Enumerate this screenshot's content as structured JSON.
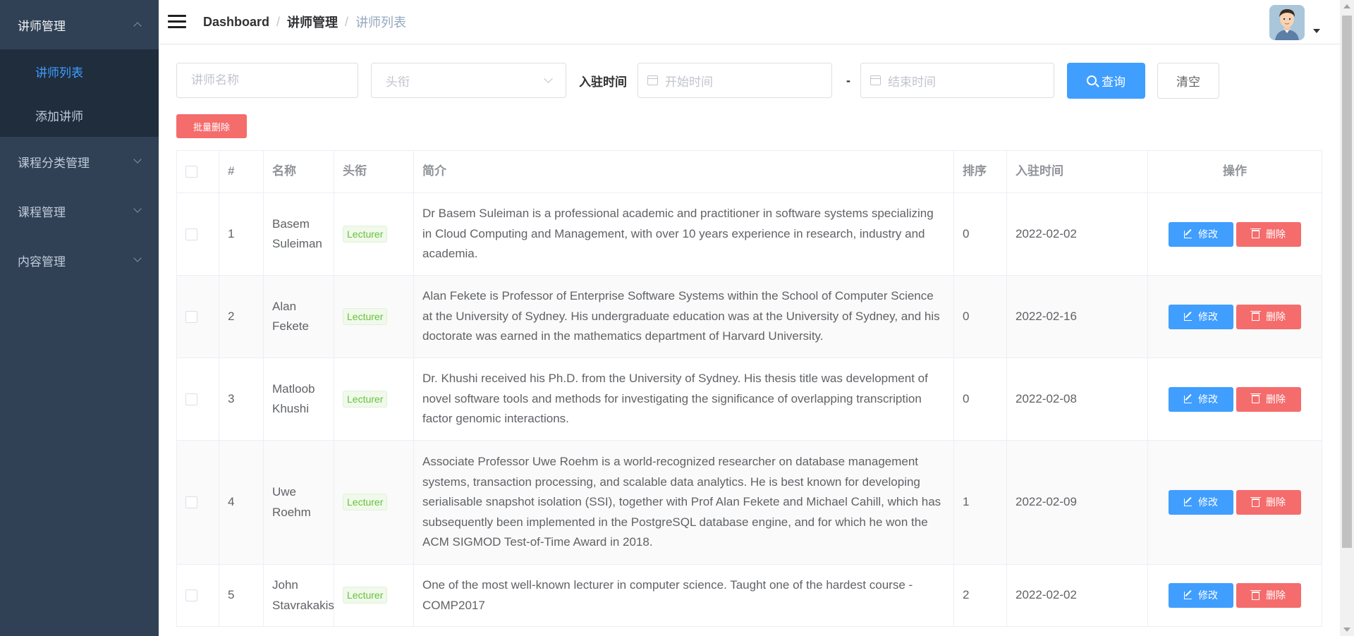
{
  "sidebar": {
    "groups": [
      {
        "label": "讲师管理",
        "expanded": true,
        "items": [
          {
            "label": "讲师列表",
            "active": true
          },
          {
            "label": "添加讲师",
            "active": false
          }
        ]
      },
      {
        "label": "课程分类管理",
        "expanded": false
      },
      {
        "label": "课程管理",
        "expanded": false
      },
      {
        "label": "内容管理",
        "expanded": false
      }
    ],
    "bg_color": "#304156",
    "active_color": "#409eff"
  },
  "navbar": {
    "breadcrumb": [
      "Dashboard",
      "讲师管理",
      "讲师列表"
    ]
  },
  "filters": {
    "name_placeholder": "讲师名称",
    "title_placeholder": "头衔",
    "date_label": "入驻时间",
    "start_placeholder": "开始时间",
    "range_separator": "-",
    "end_placeholder": "结束时间",
    "search_label": "查询",
    "clear_label": "清空"
  },
  "batch_delete_label": "批量删除",
  "table": {
    "headers": [
      "#",
      "名称",
      "头衔",
      "简介",
      "排序",
      "入驻时间",
      "操作"
    ],
    "edit_label": "修改",
    "delete_label": "删除",
    "rows": [
      {
        "index": "1",
        "name": "Basem Suleiman",
        "title": "Lecturer",
        "intro": "Dr Basem Suleiman is a professional academic and practitioner in software systems specializing in Cloud Computing and Management, with over 10 years experience in research, industry and academia.",
        "sort": "0",
        "date": "2022-02-02"
      },
      {
        "index": "2",
        "name": "Alan Fekete",
        "title": "Lecturer",
        "intro": "Alan Fekete is Professor of Enterprise Software Systems within the School of Computer Science at the University of Sydney. His undergraduate education was at the University of Sydney, and his doctorate was earned in the mathematics department of Harvard University.",
        "sort": "0",
        "date": "2022-02-16"
      },
      {
        "index": "3",
        "name": "Matloob Khushi",
        "title": "Lecturer",
        "intro": "Dr. Khushi received his Ph.D. from the University of Sydney. His thesis title was development of novel software tools and methods for investigating the significance of overlapping transcription factor genomic interactions.",
        "sort": "0",
        "date": "2022-02-08"
      },
      {
        "index": "4",
        "name": "Uwe Roehm",
        "title": "Lecturer",
        "intro": "Associate Professor Uwe Roehm is a world-recognized researcher on database management systems, transaction processing, and scalable data analytics. He is best known for developing serialisable snapshot isolation (SSI), together with Prof Alan Fekete and Michael Cahill, which has subsequently been implemented in the PostgreSQL database engine, and for which he won the ACM SIGMOD Test-of-Time Award in 2018.",
        "sort": "1",
        "date": "2022-02-09"
      },
      {
        "index": "5",
        "name": "John Stavrakakis",
        "title": "Lecturer",
        "intro": "One of the most well-known lecturer in computer science. Taught one of the hardest course - COMP2017",
        "sort": "2",
        "date": "2022-02-02"
      }
    ]
  }
}
